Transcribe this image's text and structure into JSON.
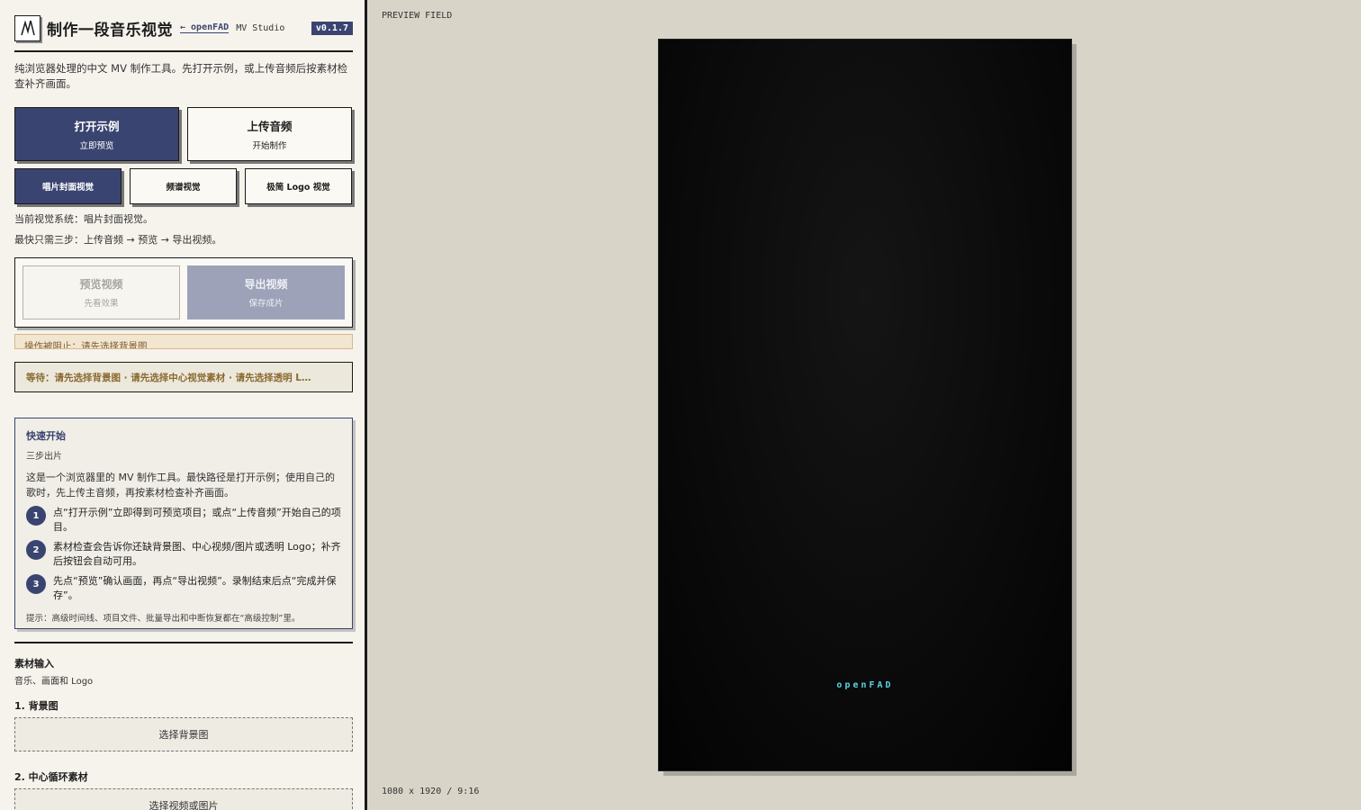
{
  "header": {
    "title": "制作一段音乐视觉",
    "back_link": "← openFAD",
    "studio": "MV Studio",
    "version": "v0.1.7"
  },
  "intro": "纯浏览器处理的中文 MV 制作工具。先打开示例，或上传音频后按素材检查补齐画面。",
  "primary_actions": {
    "open_example": {
      "label": "打开示例",
      "sub": "立即预览"
    },
    "upload_audio": {
      "label": "上传音频",
      "sub": "开始制作"
    }
  },
  "visual_systems": [
    {
      "label": "唱片封面视觉",
      "active": true
    },
    {
      "label": "频谱视觉",
      "active": false
    },
    {
      "label": "极简 Logo 视觉",
      "active": false
    }
  ],
  "current_system": "当前视觉系统：唱片封面视觉。",
  "steps_hint": "最快只需三步：上传音频 → 预览 → 导出视频。",
  "output_actions": {
    "preview": {
      "label": "预览视频",
      "sub": "先看效果"
    },
    "export": {
      "label": "导出视频",
      "sub": "保存成片"
    }
  },
  "blocked_msg": "操作被阻止：请先选择背景图",
  "waiting_msg": "等待：请先选择背景图 · 请先选择中心视觉素材 · 请先选择透明 L…",
  "quick_start": {
    "title": "快速开始",
    "subtitle": "三步出片",
    "description": "这是一个浏览器里的 MV 制作工具。最快路径是打开示例；使用自己的歌时，先上传主音频，再按素材检查补齐画面。",
    "steps": [
      {
        "num": "1",
        "text": "点“打开示例”立即得到可预览项目；或点“上传音频”开始自己的项目。"
      },
      {
        "num": "2",
        "text": "素材检查会告诉你还缺背景图、中心视频/图片或透明 Logo；补齐后按钮会自动可用。"
      },
      {
        "num": "3",
        "text": "先点“预览”确认画面，再点“导出视频”。录制结束后点“完成并保存”。"
      }
    ],
    "hint": "提示：高级时间线、项目文件、批量导出和中断恢复都在“高级控制”里。"
  },
  "assets": {
    "title": "素材输入",
    "subtitle": "音乐、画面和 Logo",
    "background": {
      "label": "1. 背景图",
      "button": "选择背景图"
    },
    "center": {
      "label": "2. 中心循环素材",
      "button": "选择视频或图片"
    }
  },
  "preview": {
    "field_label": "PREVIEW FIELD",
    "logo_text": "openFAD",
    "dimensions": "1080 x 1920 / 9:16",
    "logo_color": "#5ad2e6"
  },
  "colors": {
    "accent": "#3a4470",
    "sidebar_bg": "#f6f3ec",
    "canvas_bg": "#d8d5c8",
    "warning_bg": "#f3e6d0"
  }
}
